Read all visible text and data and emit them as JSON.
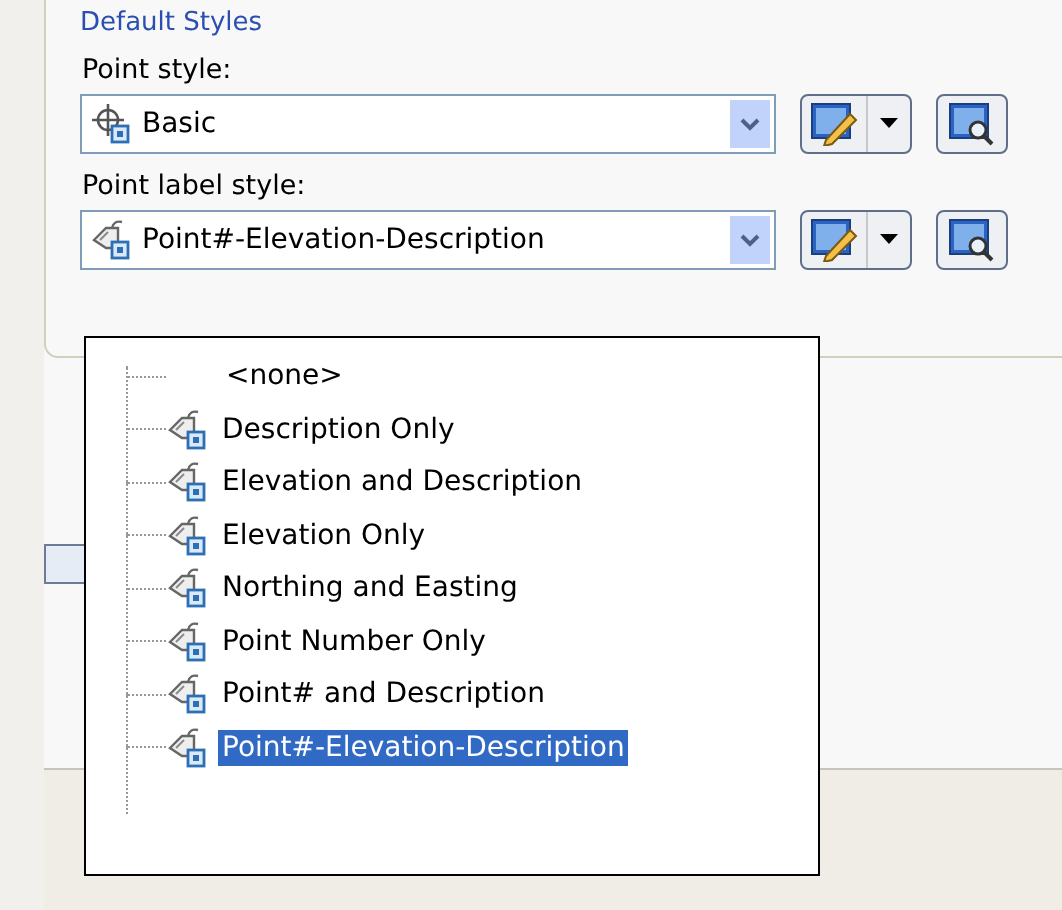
{
  "group": {
    "title": "Default Styles",
    "fields": [
      {
        "label": "Point style:",
        "value": "Basic",
        "kind": "point"
      },
      {
        "label": "Point label style:",
        "value": "Point#-Elevation-Description",
        "kind": "label"
      }
    ]
  },
  "dropdown": {
    "items": [
      {
        "label": "<none>",
        "kind": "none",
        "selected": false
      },
      {
        "label": "Description Only",
        "kind": "label",
        "selected": false
      },
      {
        "label": "Elevation and Description",
        "kind": "label",
        "selected": false
      },
      {
        "label": "Elevation Only",
        "kind": "label",
        "selected": false
      },
      {
        "label": "Northing and Easting",
        "kind": "label",
        "selected": false
      },
      {
        "label": "Point Number Only",
        "kind": "label",
        "selected": false
      },
      {
        "label": "Point# and Description",
        "kind": "label",
        "selected": false
      },
      {
        "label": "Point#-Elevation-Description",
        "kind": "label",
        "selected": true
      }
    ]
  }
}
